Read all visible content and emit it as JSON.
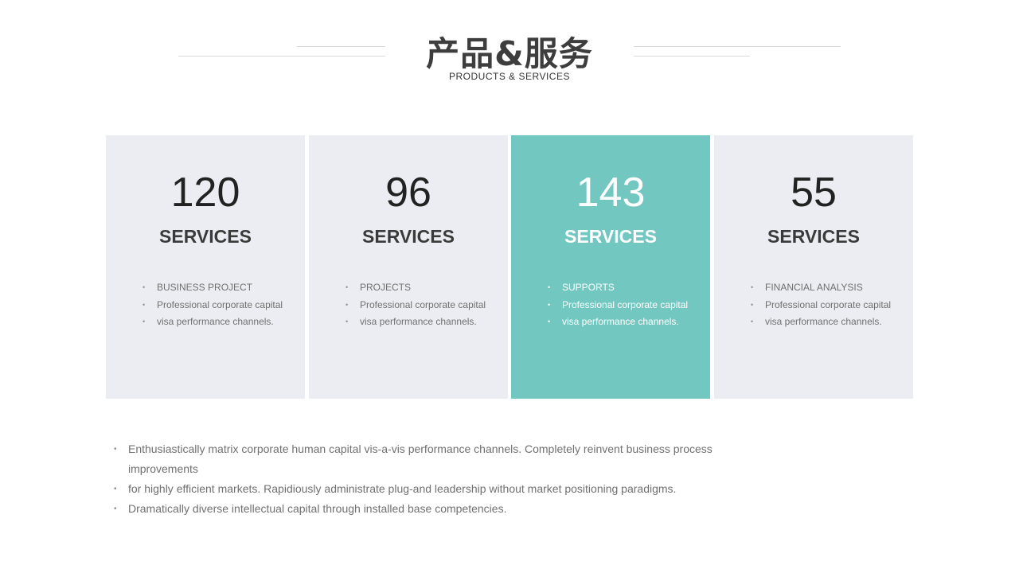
{
  "header": {
    "title": "产品&服务",
    "subtitle": "PRODUCTS  &  SERVICES"
  },
  "cards": [
    {
      "number": "120",
      "label": "SERVICES",
      "items": [
        "BUSINESS PROJECT",
        "Professional corporate capital",
        "visa performance channels."
      ]
    },
    {
      "number": "96",
      "label": "SERVICES",
      "items": [
        "PROJECTS",
        "Professional corporate capital",
        "visa performance channels."
      ]
    },
    {
      "number": "143",
      "label": "SERVICES",
      "items": [
        "SUPPORTS",
        "Professional corporate capital",
        "visa performance channels."
      ]
    },
    {
      "number": "55",
      "label": "SERVICES",
      "items": [
        "FINANCIAL ANALYSIS",
        "Professional corporate capital",
        "visa performance channels."
      ]
    }
  ],
  "bullets": [
    "Enthusiastically matrix corporate human capital vis-a-vis performance channels. Completely reinvent business process improvements",
    "for highly efficient markets. Rapidiously administrate plug-and leadership without market positioning paradigms.",
    "Dramatically diverse intellectual capital through installed base competencies."
  ],
  "colors": {
    "accent": "#72c7c0",
    "card_background": "#ecedf2",
    "title": "#3d3d3d",
    "body_text": "#707070"
  }
}
